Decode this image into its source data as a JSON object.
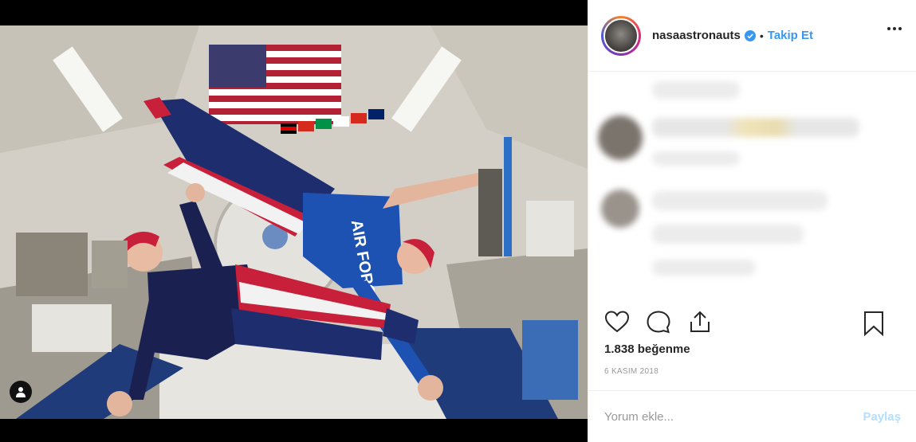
{
  "post": {
    "username": "nasaastronauts",
    "separator": "•",
    "follow_label": "Takip Et",
    "likes_text": "1.838 beğenme",
    "date_text": "6 KASIM 2018",
    "photo_text": "AIR FORCE"
  },
  "comment_box": {
    "placeholder": "Yorum ekle...",
    "post_label": "Paylaş"
  },
  "icons": {
    "verified": "verified-badge-icon",
    "more": "more-options-icon",
    "like": "heart-icon",
    "comment": "comment-bubble-icon",
    "share": "share-icon",
    "save": "bookmark-icon",
    "tagged": "user-tag-icon"
  },
  "colors": {
    "accent": "#3897f0",
    "text": "#262626",
    "muted": "#999999",
    "post_disabled": "#b2dffc"
  }
}
